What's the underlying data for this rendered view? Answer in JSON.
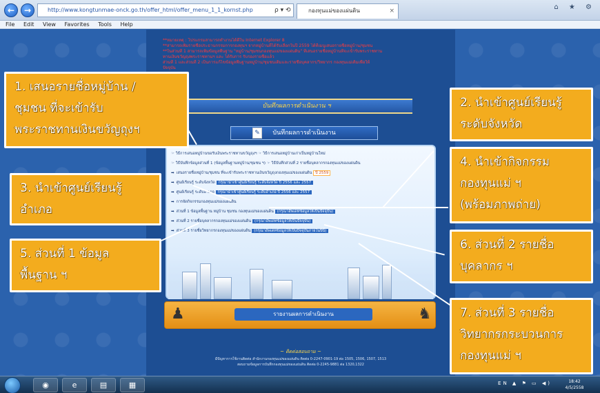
{
  "browser": {
    "back_glyph": "←",
    "forward_glyph": "→",
    "address": "http://www.kongtunmae-onck.go.th/offer_html/offer_menu_1_1_kornst.php",
    "address_controls": "ρ ▾ ⟲",
    "tab_title": "กองทุนแม่ของแผ่นดิน",
    "tab_close": "×",
    "window_controls": "⌂ ★ ⚙",
    "menu": [
      "File",
      "Edit",
      "View",
      "Favorites",
      "Tools",
      "Help"
    ]
  },
  "notice_lines": [
    "**หมายเหตุ : โปรแกรมสามารถทำงานได้ดีใน Internet Explorer 8",
    "**สามารถเพิ่มรายชื่อประธานกรรมการกองทุนฯ จากหมู่บ้านที่ได้รับเลือกในปี 2559 ได้ที่เมนูเสนอรายชื่อหมู่บ้าน/ชุมชน",
    "",
    "**ในส่วนที่ 1 สามารถเพิ่มข้อมูลพื้นฐาน \"หมู่บ้าน/ชุมชนกองทุนแม่ของแผ่นดิน\" ที่เสนอรายชื่อหมู่บ้านที่จะเข้ารับพระราชทาน",
    "ทานเงินขวัญถุงพระราชทานฯ และ ได้รับการ รับรองรายชื่อแล้ว",
    "",
    "ส่วนที่ 1 และส่วนที่ 2 เป็นการแก้ไขข้อมูลพื้นฐานหมู่บ้าน/ชุมชนเดิมและรายชื่อบุคลากร/วิทยากร กองทุนแม่เดิมเพื่อให้",
    "ปัจจุบัน"
  ],
  "banner_title": "บันทึกผลการดำเนินงาน ฯ",
  "record_button": "บันทึกผลการดำเนินงาน",
  "record_icon": "✎",
  "menu_rows": [
    {
      "text": "☞ วิธีการเสนอหมู่บ้านขอรับเงินพระราชทานขวัญถุงฯ   ☞ วิธีการเสนอหมู่บ้านเก่าเป็นหมู่บ้านใหม่"
    },
    {
      "text": "☞ วิธีบันทึกข้อมูลส่วนที่ 1 (ข้อมูลพื้นฐานหมู่บ้าน/ชุมชน ฯ)   ☞ วิธีบันทึกส่วนที่ 2 รายชื่อบุคลากรกองทุนแม่ของแผ่นดิน"
    },
    {
      "text": "เสนอรายชื่อหมู่บ้าน/ชุมชน ที่จะเข้ารับพระราชทานเงินขวัญถุงกองทุนแม่ของแผ่นดิน",
      "pill": "ปี 2559"
    },
    {
      "text": "ศูนย์เรียนรู้ ระดับจังหวัด ",
      "hl": "กรุณานำเข้าศูนย์เรียนรู้ ระดับจังหวัด ปี 2556 และ 2557"
    },
    {
      "text": "ศูนย์เรียนรู้ ระดับอำเภอ ",
      "hl": "กรุณานำเข้าศูนย์เรียนรู้ ระดับอำเภอ ปี 2556 และ 2557"
    },
    {
      "text": "การจัดกิจกรรมกองทุนแม่ของแผ่นดิน"
    },
    {
      "text": "ส่วนที่ 1 ข้อมูลพื้นฐาน หมู่บ้าน ชุมชน กองทุนแม่ของแผ่นดิน ",
      "hl": "(กรุณาอัพเดทข้อมูลให้เป็นปัจจุบัน)"
    },
    {
      "text": "ส่วนที่ 2 รายชื่อบุคลากรกองทุนแม่ของแผ่นดิน ",
      "hl": "(กรุณาอัพเดทข้อมูลให้เป็นปัจจุบัน)"
    },
    {
      "text": "ส่วนที่ 3 รายชื่อวิทยากรกองทุนแม่ของแผ่นดิน ",
      "hl": "(กรุณาอัพเดทข้อมูลให้เป็นปัจจุบันภายในปีนี้)"
    }
  ],
  "report_button": "รายงานผลการดำเนินงาน",
  "footer_title": "~ ติดต่อสอบถาม ~",
  "footer_lines": [
    "มีปัญหาการใช้งานติดต่อ สำนักงานกองทุนแม่ของแผ่นดิน ติดต่อ 0-2247-0901-19 ต่อ 1505, 1506, 1507, 1513",
    "สอบถามข้อมูลการบันทึกกองทุนแม่ของแผ่นดิน ติดต่อ 0-2245-9881 ต่อ 1320,1322"
  ],
  "callouts": {
    "c1": [
      "1. เสนอรายชื่อหมู่บ้าน /",
      "ชุมชน ที่จะเข้ารับ",
      "พระราชทานเงินขวัญถุงฯ"
    ],
    "c2": [
      "2. นำเข้าศูนย์เรียนรู้",
      "ระดับจังหวัด"
    ],
    "c3": [
      "3. นำเข้าศูนย์เรียนรู้",
      "อำเภอ"
    ],
    "c4": [
      "4. นำเข้ากิจกรรม",
      "กองทุนแม่ ฯ",
      "(พร้อมภาพถ่าย)"
    ],
    "c5": [
      "5. ส่วนที่ 1 ข้อมูล",
      "พื้นฐาน ฯ"
    ],
    "c6": [
      "6. ส่วนที่ 2 รายชื่อ",
      "บุคลากร ฯ"
    ],
    "c7": [
      "7. ส่วนที่ 3 รายชื่อ",
      "วิทยากรกระบวนการ",
      "กองทุนแม่ ฯ"
    ]
  },
  "taskbar": {
    "apps": [
      "◉",
      "e",
      "▤",
      "▦"
    ],
    "tray": "EN ▲ ⚑ ▭ ◀)",
    "time": "18:42",
    "date": "4/5/2558"
  },
  "colors": {
    "callout_bg": "#f3ac1e",
    "page_bg": "#2b62ad",
    "notice_text": "#ff3b3b"
  }
}
